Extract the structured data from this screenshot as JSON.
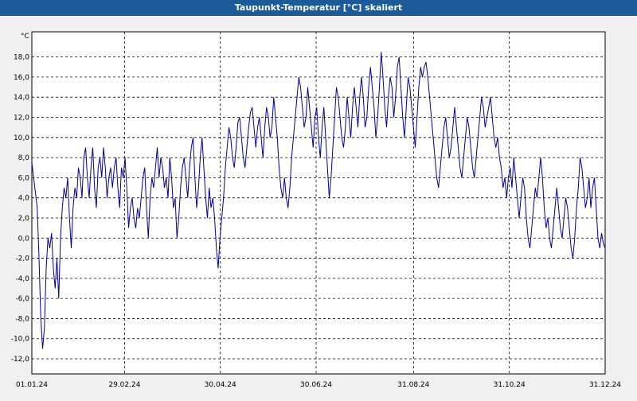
{
  "window": {
    "title": "Taupunkt-Temperatur [°C] skaliert"
  },
  "chart_data": {
    "type": "line",
    "title": "Taupunkt-Temperatur [°C] skaliert",
    "unit_label": "°C",
    "ylim": [
      -13.5,
      20.5
    ],
    "yticks": [
      "18,0",
      "16,0",
      "14,0",
      "12,0",
      "10,0",
      "8,0",
      "6,0",
      "4,0",
      "2,0",
      "0,0",
      "-2,0",
      "-4,0",
      "-6,0",
      "-8,0",
      "-10,0",
      "-12,0"
    ],
    "ytick_values": [
      18,
      16,
      14,
      12,
      10,
      8,
      6,
      4,
      2,
      0,
      -2,
      -4,
      -6,
      -8,
      -10,
      -12
    ],
    "xlim": [
      "01.01.24",
      "31.12.24"
    ],
    "xticks": [
      "01.01.24",
      "29.02.24",
      "30.04.24",
      "30.06.24",
      "31.08.24",
      "31.10.24",
      "31.12.24"
    ],
    "xtick_days": [
      0,
      59,
      120,
      181,
      243,
      304,
      365
    ],
    "grid": true,
    "series": [
      {
        "color": "#0000a0",
        "x_start": "01.01.24",
        "x_step_days": 1,
        "values": [
          7.5,
          6.0,
          4.5,
          3.0,
          -2.0,
          -8.0,
          -11.0,
          -9.0,
          -3.0,
          0.0,
          -1.0,
          0.5,
          -3.0,
          -5.0,
          -2.0,
          -6.0,
          0.0,
          3.0,
          5.0,
          4.0,
          6.0,
          2.0,
          -1.0,
          3.0,
          5.0,
          4.0,
          7.0,
          6.0,
          4.0,
          8.0,
          9.0,
          6.0,
          4.0,
          7.0,
          9.0,
          5.0,
          3.0,
          7.0,
          8.0,
          6.0,
          9.0,
          7.0,
          4.0,
          6.0,
          7.0,
          5.0,
          7.0,
          8.0,
          5.0,
          3.0,
          7.0,
          6.0,
          8.0,
          5.0,
          1.0,
          3.0,
          4.0,
          2.0,
          1.0,
          3.0,
          2.0,
          4.0,
          6.0,
          7.0,
          3.0,
          0.0,
          4.0,
          6.0,
          5.0,
          7.0,
          9.0,
          6.0,
          8.0,
          7.0,
          5.0,
          6.0,
          4.0,
          8.0,
          6.0,
          3.0,
          4.0,
          0.0,
          2.0,
          5.0,
          7.0,
          8.0,
          6.0,
          4.0,
          7.0,
          9.0,
          10.0,
          6.0,
          3.0,
          5.0,
          8.0,
          10.0,
          7.0,
          4.0,
          2.0,
          5.0,
          3.0,
          4.0,
          2.0,
          -1.0,
          -3.0,
          0.0,
          2.0,
          4.0,
          7.0,
          9.0,
          11.0,
          10.0,
          8.0,
          7.0,
          9.0,
          11.5,
          12.0,
          10.0,
          8.0,
          7.0,
          9.0,
          11.0,
          12.5,
          13.0,
          11.0,
          9.0,
          11.0,
          12.0,
          10.0,
          8.0,
          11.0,
          13.0,
          12.0,
          10.0,
          11.0,
          14.0,
          12.0,
          10.0,
          7.0,
          5.0,
          4.0,
          6.0,
          4.0,
          3.0,
          5.0,
          8.0,
          10.0,
          12.0,
          14.0,
          16.0,
          15.0,
          13.0,
          11.0,
          12.0,
          15.0,
          13.0,
          11.0,
          9.0,
          12.0,
          13.0,
          10.0,
          8.0,
          11.0,
          13.0,
          10.0,
          7.0,
          4.0,
          6.0,
          9.0,
          12.0,
          15.0,
          14.0,
          12.0,
          10.0,
          9.0,
          11.0,
          14.0,
          12.0,
          10.0,
          13.0,
          15.0,
          13.0,
          11.0,
          14.0,
          16.0,
          14.0,
          11.0,
          12.0,
          15.0,
          17.0,
          15.0,
          13.0,
          10.0,
          12.0,
          15.0,
          18.5,
          16.0,
          13.0,
          11.0,
          14.0,
          16.0,
          15.0,
          12.0,
          14.0,
          17.0,
          18.0,
          15.0,
          12.0,
          10.0,
          13.0,
          16.0,
          15.0,
          13.0,
          11.0,
          9.0,
          12.0,
          15.0,
          17.0,
          16.0,
          17.0,
          17.5,
          16.0,
          14.0,
          12.0,
          10.0,
          8.0,
          6.0,
          5.0,
          7.0,
          9.0,
          11.0,
          12.0,
          10.0,
          8.0,
          9.0,
          11.0,
          13.0,
          11.0,
          9.0,
          7.0,
          6.0,
          8.0,
          10.0,
          12.0,
          11.0,
          9.0,
          7.0,
          6.0,
          8.0,
          10.0,
          12.0,
          14.0,
          13.0,
          11.0,
          12.0,
          13.0,
          14.0,
          12.0,
          10.0,
          9.0,
          10.0,
          8.0,
          7.0,
          5.0,
          6.0,
          4.0,
          6.0,
          7.0,
          5.0,
          8.0,
          6.0,
          4.0,
          2.0,
          4.0,
          6.0,
          5.0,
          2.0,
          0.0,
          -1.0,
          1.0,
          3.0,
          5.0,
          4.0,
          6.0,
          8.0,
          6.0,
          3.0,
          1.0,
          2.0,
          0.0,
          -1.0,
          1.0,
          3.0,
          5.0,
          3.0,
          1.0,
          0.0,
          2.0,
          4.0,
          3.0,
          1.0,
          -1.0,
          -2.0,
          0.0,
          3.0,
          5.0,
          8.0,
          7.0,
          5.0,
          3.0,
          4.0,
          6.0,
          3.0,
          5.0,
          6.0,
          3.0,
          0.0,
          -1.0,
          0.5,
          -0.5,
          -1.0
        ]
      }
    ]
  }
}
